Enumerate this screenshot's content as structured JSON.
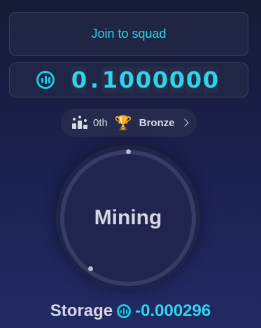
{
  "squad": {
    "button_label": "Join to squad"
  },
  "balance": {
    "icon": "coin-icon",
    "digits": [
      "0",
      ".",
      "1",
      "0",
      "0",
      "0",
      "0",
      "0",
      "0"
    ]
  },
  "rank": {
    "position": "0th",
    "league": "Bronze",
    "icons": [
      "podium-icon",
      "trophy-icon",
      "chevron-right-icon"
    ]
  },
  "mining": {
    "label": "Mining"
  },
  "storage": {
    "label": "Storage",
    "value": "-0.000296",
    "icon": "coin-icon"
  },
  "colors": {
    "accent": "#2fd4e8",
    "background_top": "#161b35",
    "background_bottom": "#232a64",
    "panel": "#262c4a",
    "text_muted": "#d4d6e2"
  }
}
